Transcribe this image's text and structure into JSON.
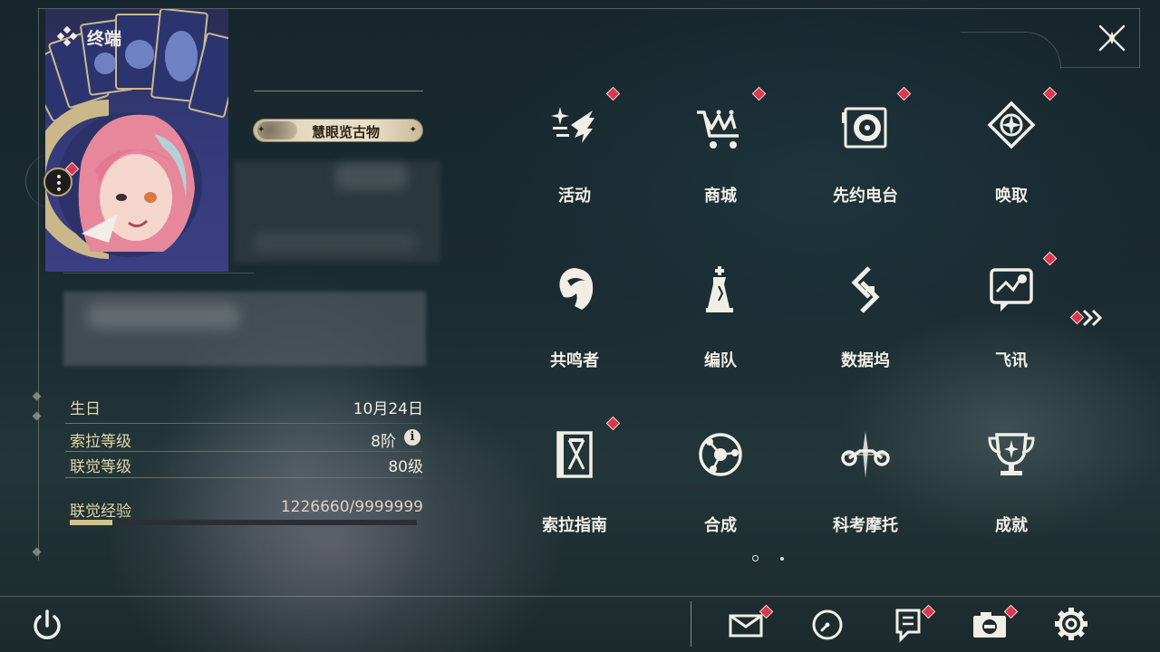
{
  "header": {
    "title": "终端"
  },
  "profile": {
    "badge_label": "慧眼览古物",
    "stats": [
      {
        "label": "生日",
        "value": "10月24日"
      },
      {
        "label": "索拉等级",
        "value": "8阶"
      },
      {
        "label": "联觉等级",
        "value": "80级"
      },
      {
        "label": "联觉经验",
        "value": "1226660/9999999"
      }
    ],
    "exp_progress": 0.123,
    "info_glyph": "i"
  },
  "menu": {
    "items": [
      {
        "label": "活动",
        "icon": "sparkle-feather-icon",
        "notify": true
      },
      {
        "label": "商城",
        "icon": "crown-cart-icon",
        "notify": true
      },
      {
        "label": "先约电台",
        "icon": "turntable-icon",
        "notify": true
      },
      {
        "label": "唤取",
        "icon": "compass-star-icon",
        "notify": true
      },
      {
        "label": "共鸣者",
        "icon": "character-head-icon",
        "notify": false
      },
      {
        "label": "编队",
        "icon": "chess-pieces-icon",
        "notify": false
      },
      {
        "label": "数据坞",
        "icon": "data-dock-icon",
        "notify": false
      },
      {
        "label": "飞讯",
        "icon": "message-bubble-icon",
        "notify": true
      },
      {
        "label": "索拉指南",
        "icon": "guide-book-icon",
        "notify": true
      },
      {
        "label": "合成",
        "icon": "synthesis-orbit-icon",
        "notify": false
      },
      {
        "label": "科考摩托",
        "icon": "motorbike-icon",
        "notify": false
      },
      {
        "label": "成就",
        "icon": "trophy-icon",
        "notify": false
      }
    ],
    "current_page": 1,
    "page_count": 2
  },
  "bottom_bar": {
    "buttons": [
      {
        "icon": "mail-icon",
        "notify": true
      },
      {
        "icon": "clock-icon",
        "notify": false
      },
      {
        "icon": "notice-icon",
        "notify": true
      },
      {
        "icon": "camera-icon",
        "notify": true
      },
      {
        "icon": "settings-icon",
        "notify": false
      }
    ]
  },
  "colors": {
    "accent_gold": "#e3d5a8",
    "notify_red": "#d9384e",
    "exp_bar": "#d2c291"
  }
}
